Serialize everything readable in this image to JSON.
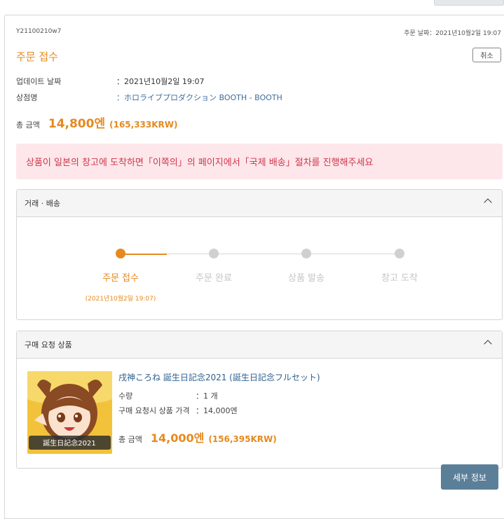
{
  "order": {
    "id": "Y21100210w7",
    "date_label": "주문 날짜：",
    "date_value": "2021년10월2일 19:07",
    "status": "주문 접수",
    "cancel_label": "취소"
  },
  "info": {
    "updated_label": "업데이트 날짜",
    "updated_value": "：2021년10월2일 19:07",
    "shop_label": "상점명",
    "shop_value": "：ホロライブプロダクション BOOTH - BOOTH"
  },
  "total": {
    "label": "총 금액",
    "amount": "14,800엔",
    "krw": "(165,333KRW)"
  },
  "alert": "상품이 일본의 창고에 도착하면「이쪽의」의 페이지에서「국제 배송」절차를 진행해주세요",
  "shipping_panel": {
    "title": "거래 · 배송",
    "steps": [
      {
        "label": "주문 접수",
        "active": true
      },
      {
        "label": "주문 완료",
        "active": false
      },
      {
        "label": "상품 발송",
        "active": false
      },
      {
        "label": "창고 도착",
        "active": false
      }
    ],
    "step_date": "(2021년10월2일 19:07)"
  },
  "items_panel": {
    "title": "구매 요청 상품",
    "product": {
      "title": "戌神ころね 誕生日記念2021 (誕生日記念フルセット)",
      "qty_label": "수량",
      "qty_value": "：1 개",
      "price_label": "구매 요청시 상품 가격",
      "price_value": "：14,000엔",
      "total_label": "총 금액",
      "total_amount": "14,000엔",
      "total_krw": "(156,395KRW)",
      "thumb_text": "誕生日記念2021"
    }
  },
  "detail_button": "세부 정보",
  "colors": {
    "accent": "#e58a1f",
    "alert_bg": "#fde7ea",
    "alert_text": "#d0354c",
    "button": "#5b7f99"
  }
}
